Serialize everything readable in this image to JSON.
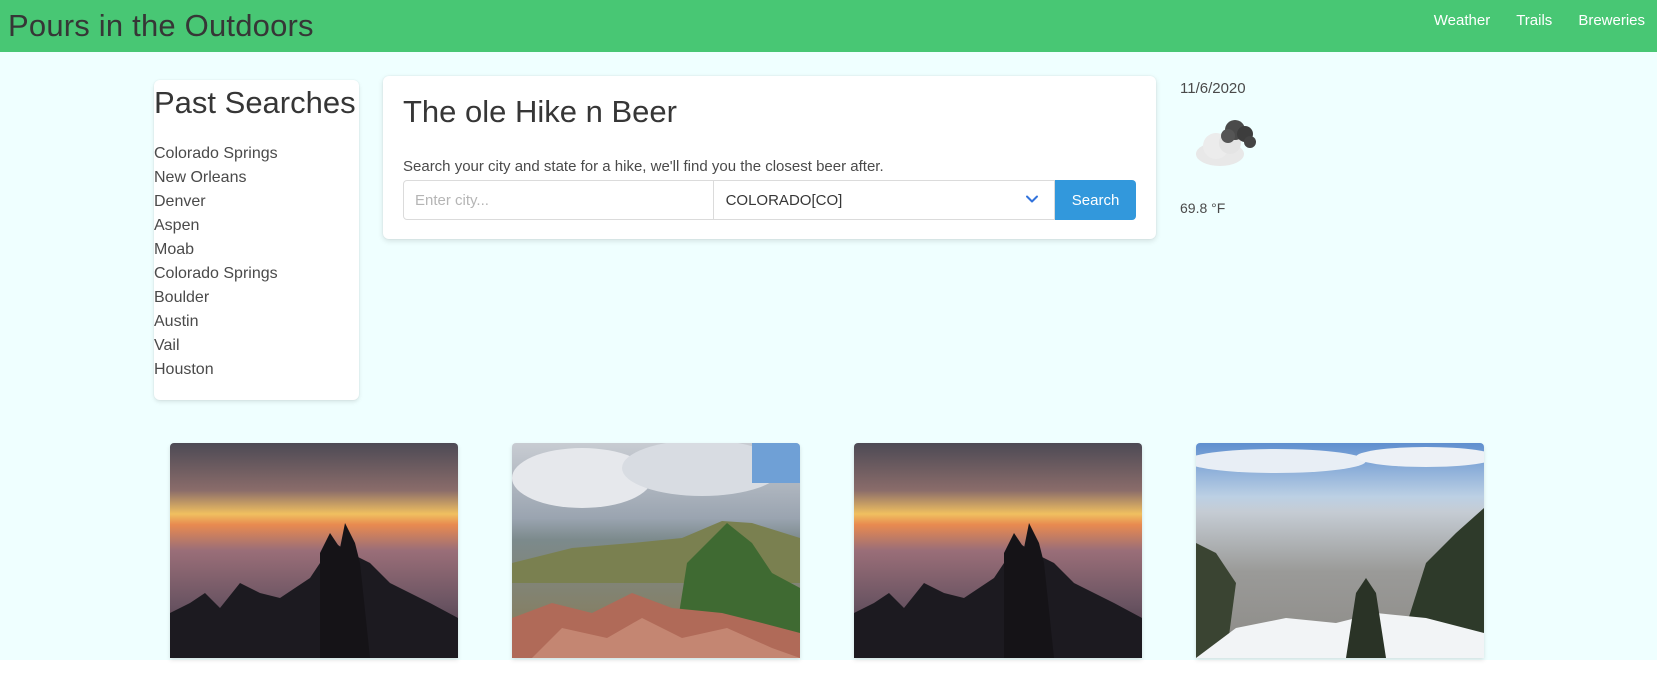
{
  "navbar": {
    "brand": "Pours in the Outdoors",
    "links": [
      "Weather",
      "Trails",
      "Breweries"
    ],
    "background": "#48c774"
  },
  "past_searches": {
    "title": "Past Searches",
    "items": [
      "Colorado Springs",
      "New Orleans",
      "Denver",
      "Aspen",
      "Moab",
      "Colorado Springs",
      "Boulder",
      "Austin",
      "Vail",
      "Houston"
    ]
  },
  "search_box": {
    "title": "The ole Hike n Beer",
    "subtitle": "Search your city and state for a hike, we'll find you the closest beer after.",
    "city_placeholder": "Enter city...",
    "state_selected": "COLORADO[CO]",
    "button_label": "Search",
    "button_color": "#3298dc"
  },
  "weather": {
    "date": "11/6/2020",
    "icon": "cloudy-icon",
    "temperature": "69.8 °F"
  },
  "trail_images": [
    {
      "icon": "sunset-clouds-image"
    },
    {
      "icon": "mountain-ridge-image"
    },
    {
      "icon": "sunset-clouds-image"
    },
    {
      "icon": "snowy-valley-city-image"
    }
  ]
}
